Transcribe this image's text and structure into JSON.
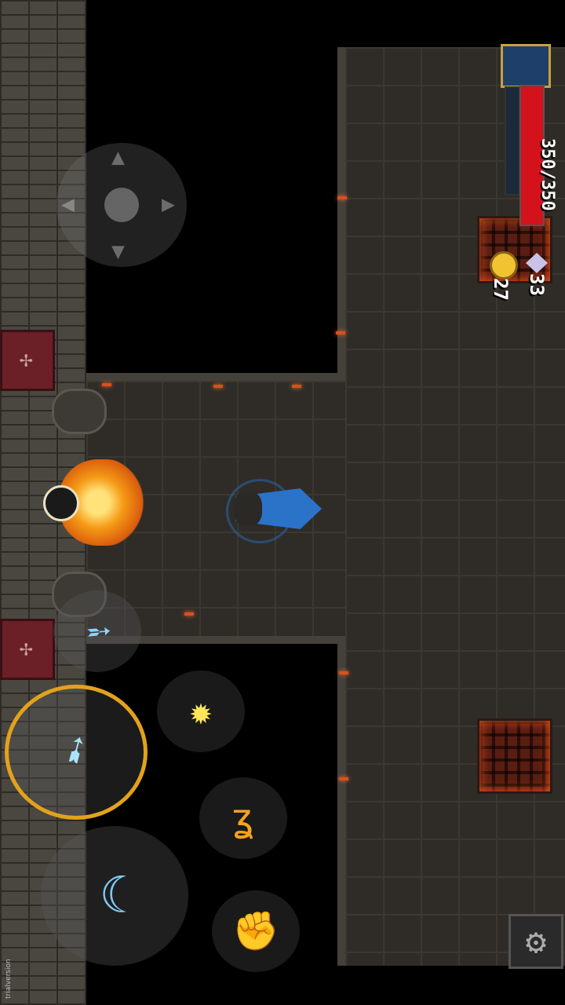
{
  "hud": {
    "health_text": "350/350",
    "health_fraction": 1.0,
    "health_color": "#d4121b",
    "gold_count": "27",
    "gem_count": "33",
    "gold_icon": "coin-icon",
    "gem_icon": "crystal-icon"
  },
  "controls": {
    "joystick": "virtual-joystick",
    "settings_icon": "gear-icon",
    "skills": [
      {
        "name": "ice-spear-skill",
        "icon": "ice-spear-icon"
      },
      {
        "name": "frost-arrow-skill",
        "icon": "frost-arrow-icon"
      },
      {
        "name": "light-burst-skill",
        "icon": "light-burst-icon"
      },
      {
        "name": "flame-serpent-skill",
        "icon": "flame-serpent-icon"
      },
      {
        "name": "water-crescent-skill",
        "icon": "water-crescent-icon"
      },
      {
        "name": "earth-fist-skill",
        "icon": "earth-fist-icon"
      }
    ]
  },
  "watermark": "trialversion",
  "colors": {
    "accent_ring": "#e2a21c",
    "player": "#2a73c9",
    "enemy_fire": "#f59a16"
  }
}
